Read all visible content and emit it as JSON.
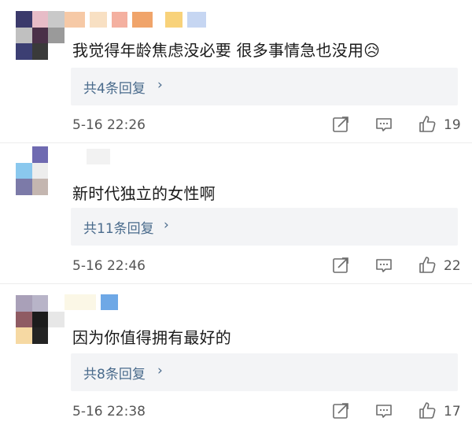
{
  "comments": [
    {
      "text": "我觉得年龄焦虑没必要 很多事情急也没用😥",
      "reply_label": "共4条回复",
      "time": "5-16 22:26",
      "likes": "19",
      "avatar_colors": [
        "#3b3a6b",
        "#e7bcc7",
        "#c9c9c9",
        "#c0c0c0",
        "#4a3048",
        "#9a9a9a",
        "#3c3f73",
        "#3a3a3a",
        "#ffffff"
      ],
      "name_colors": [
        "#f6c9a6",
        "#f8e0c3",
        "#f4b0a0",
        "#f0a46a",
        "#ffffff",
        "#f8d27a",
        "#c6d6f2"
      ]
    },
    {
      "text": "新时代独立的女性啊",
      "reply_label": "共11条回复",
      "time": "5-16 22:46",
      "likes": "22",
      "avatar_colors": [
        "#ffffff",
        "#6f6ab1",
        "#ffffff",
        "#8ac8ee",
        "#ededed",
        "#ffffff",
        "#7c7aa8",
        "#c4b6b0",
        "#ffffff"
      ],
      "name_colors": [
        "#ffffff",
        "#f2f2f2"
      ]
    },
    {
      "text": "因为你值得拥有最好的",
      "reply_label": "共8条回复",
      "time": "5-16 22:38",
      "likes": "17",
      "avatar_colors": [
        "#a9a0b8",
        "#b8b4c8",
        "#ffffff",
        "#8f5b63",
        "#1c1c1c",
        "#e7e7e7",
        "#f6d9a3",
        "#242424",
        "#ffffff"
      ],
      "name_colors": [
        "#fbf7e6",
        "#6ea8e6"
      ]
    }
  ],
  "colors": {
    "reply_bg": "#f3f4f6",
    "reply_text": "#4a6b8c",
    "meta_text": "#555555",
    "icon": "#6d6d6d"
  },
  "icons": [
    "share-icon",
    "comment-icon",
    "like-icon",
    "chevron-right-icon"
  ]
}
